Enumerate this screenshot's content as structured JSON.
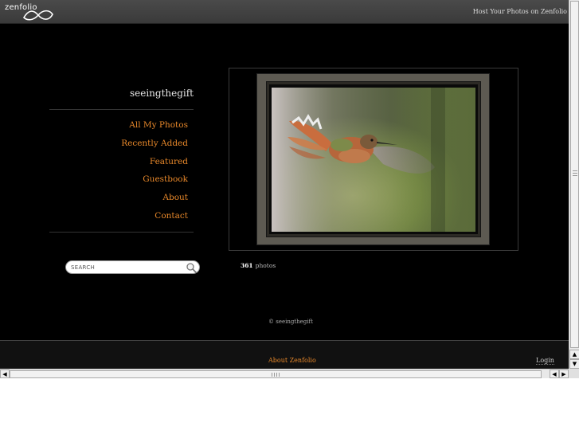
{
  "header": {
    "logo_text": "zenfolio",
    "host_link": "Host Your Photos on Zenfolio"
  },
  "sidebar": {
    "site_title": "seeingthegift",
    "items": [
      {
        "label": "All My Photos"
      },
      {
        "label": "Recently Added"
      },
      {
        "label": "Featured"
      },
      {
        "label": "Guestbook"
      },
      {
        "label": "About"
      },
      {
        "label": "Contact"
      }
    ]
  },
  "search": {
    "placeholder": "SEARCH",
    "icon": "magnifier-icon"
  },
  "main": {
    "photo_count": "361",
    "photo_count_label": "photos",
    "featured_photo": "hummingbird-in-flight"
  },
  "copyright": "© seeingthegift",
  "footer": {
    "about_link": "About Zenfolio",
    "login_link": "Login"
  },
  "colors": {
    "accent": "#e8882a",
    "background": "#000000"
  }
}
